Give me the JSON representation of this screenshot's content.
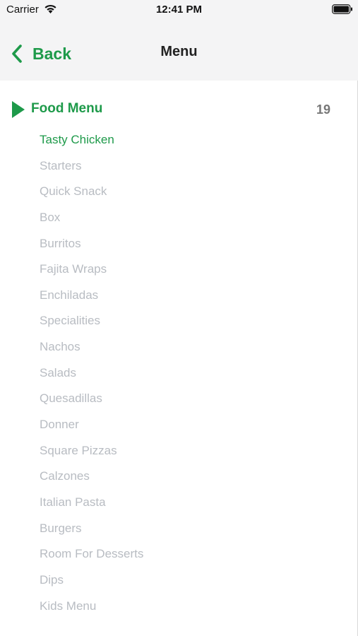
{
  "status_bar": {
    "carrier": "Carrier",
    "time": "12:41 PM",
    "wifi_icon": "wifi-icon",
    "battery_icon": "battery-icon"
  },
  "nav": {
    "back_label": "Back",
    "title": "Menu"
  },
  "section": {
    "title": "Food Menu",
    "count": "19"
  },
  "menu_items": [
    "Tasty Chicken",
    "Starters",
    "Quick Snack",
    "Box",
    "Burritos",
    "Fajita Wraps",
    "Enchiladas",
    "Specialities",
    "Nachos",
    "Salads",
    "Quesadillas",
    "Donner",
    "Square Pizzas",
    "Calzones",
    "Italian Pasta",
    "Burgers",
    "Room For Desserts",
    "Dips",
    "Kids Menu"
  ],
  "active_index": 0,
  "colors": {
    "accent": "#1e9a4a",
    "inactive_item": "#b8bcc2",
    "bar_background": "#f4f4f5"
  }
}
